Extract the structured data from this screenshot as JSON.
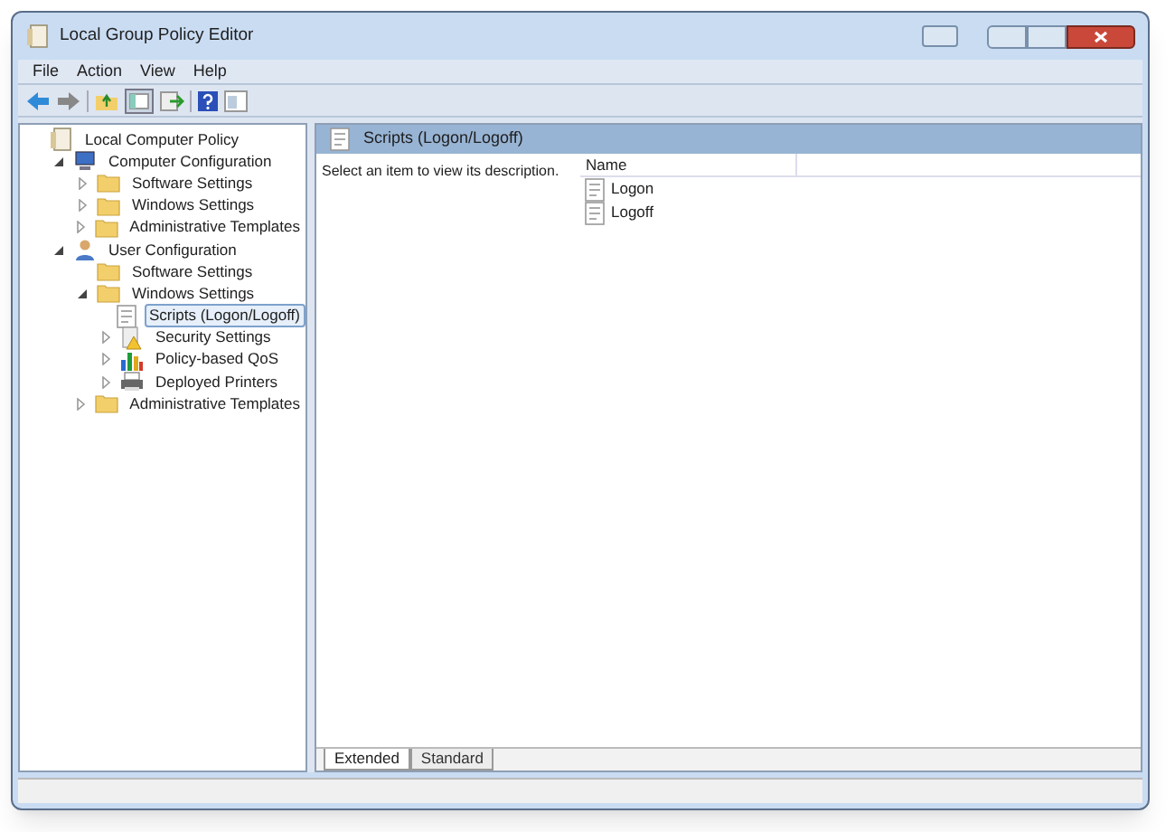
{
  "window": {
    "title": "Local Group Policy Editor"
  },
  "menu": [
    "File",
    "Action",
    "View",
    "Help"
  ],
  "tree": [
    {
      "label": "Local Computer Policy",
      "kind": "policy",
      "selected": false,
      "children": [
        {
          "label": "Computer Configuration",
          "kind": "computer",
          "selected": false,
          "expanded": true,
          "children": [
            {
              "label": "Software Settings",
              "kind": "folder",
              "selected": false,
              "expanded": false
            },
            {
              "label": "Windows Settings",
              "kind": "folder",
              "selected": false,
              "expanded": false
            },
            {
              "label": "Administrative Templates",
              "kind": "folder",
              "selected": false,
              "expanded": false
            }
          ]
        },
        {
          "label": "User Configuration",
          "kind": "user",
          "selected": false,
          "expanded": true,
          "children": [
            {
              "label": "Software Settings",
              "kind": "folder",
              "selected": false
            },
            {
              "label": "Windows Settings",
              "kind": "folder",
              "selected": false,
              "expanded": true,
              "children": [
                {
                  "label": "Scripts (Logon/Logoff)",
                  "kind": "script",
                  "selected": true
                },
                {
                  "label": "Security Settings",
                  "kind": "security",
                  "selected": false,
                  "expanded": false
                },
                {
                  "label": "Policy-based QoS",
                  "kind": "qos",
                  "selected": false,
                  "expanded": false
                },
                {
                  "label": "Deployed Printers",
                  "kind": "printer",
                  "selected": false,
                  "expanded": false
                }
              ]
            },
            {
              "label": "Administrative Templates",
              "kind": "folder",
              "selected": false,
              "expanded": false
            }
          ]
        }
      ]
    }
  ],
  "panel": {
    "title": "Scripts (Logon/Logoff)",
    "description": "Select an item to view its description.",
    "columns": [
      "Name"
    ],
    "items": [
      {
        "name": "Logon"
      },
      {
        "name": "Logoff"
      }
    ]
  },
  "tabs": [
    {
      "label": "Extended",
      "selected": true
    },
    {
      "label": "Standard",
      "selected": false
    }
  ]
}
